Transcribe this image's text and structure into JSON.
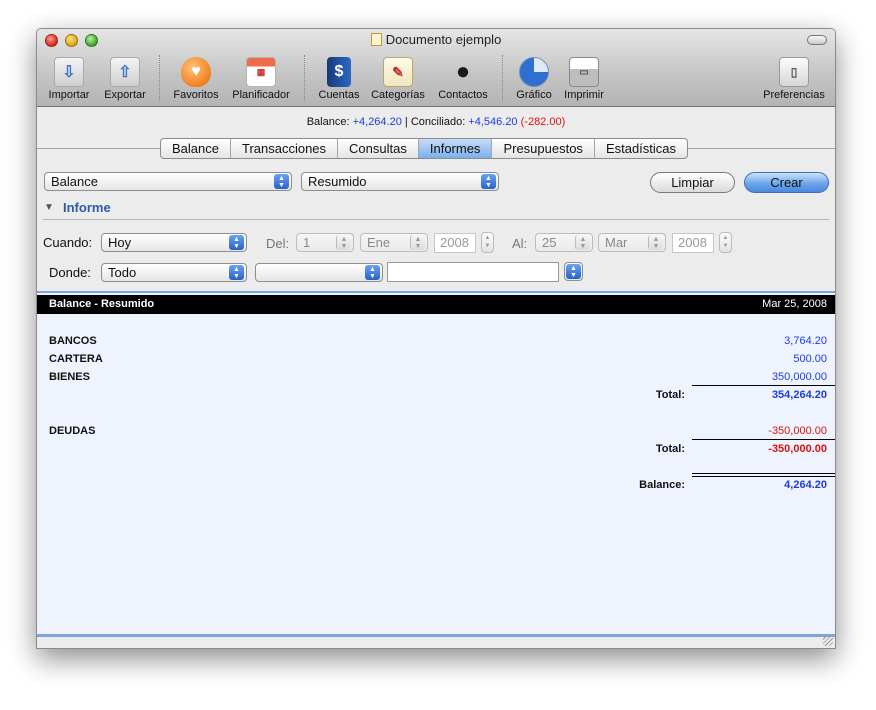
{
  "window": {
    "title": "Documento ejemplo"
  },
  "toolbar": {
    "items": [
      {
        "id": "importar",
        "label": "Importar",
        "icon": "import-icon",
        "color": "#5a8fd6"
      },
      {
        "id": "exportar",
        "label": "Exportar",
        "icon": "export-icon",
        "color": "#5a8fd6"
      },
      {
        "id": "favoritos",
        "label": "Favoritos",
        "icon": "heart-icon",
        "color": "#f08a2a"
      },
      {
        "id": "planificador",
        "label": "Planificador",
        "icon": "calendar-icon",
        "color": "#e0583a"
      },
      {
        "id": "cuentas",
        "label": "Cuentas",
        "icon": "ledger-icon",
        "color": "#2b5fb0"
      },
      {
        "id": "categorias",
        "label": "Categorías",
        "icon": "notepad-icon",
        "color": "#c9a74a"
      },
      {
        "id": "contactos",
        "label": "Contactos",
        "icon": "person-icon",
        "color": "#222222"
      },
      {
        "id": "grafico",
        "label": "Gráfico",
        "icon": "pie-chart-icon",
        "color": "#3c7fd8"
      },
      {
        "id": "imprimir",
        "label": "Imprimir",
        "icon": "printer-icon",
        "color": "#a0a0a0"
      },
      {
        "id": "preferencias",
        "label": "Preferencias",
        "icon": "switch-icon",
        "color": "#cfcfcf"
      }
    ]
  },
  "summary": {
    "balance_label": "Balance:",
    "balance_value": "+4,264.20",
    "separator": " | ",
    "conciliado_label": "Conciliado:",
    "conciliado_value": "+4,546.20",
    "difference": "(-282.00)"
  },
  "tabs": [
    "Balance",
    "Transacciones",
    "Consultas",
    "Informes",
    "Presupuestos",
    "Estadísticas"
  ],
  "active_tab": "Informes",
  "report_controls": {
    "type_value": "Balance",
    "mode_value": "Resumido",
    "limpiar_label": "Limpiar",
    "crear_label": "Crear",
    "section_title": "Informe",
    "cuando_label": "Cuando:",
    "cuando_value": "Hoy",
    "del_label": "Del:",
    "del_day": "1",
    "del_month": "Ene",
    "del_year": "2008",
    "al_label": "Al:",
    "al_day": "25",
    "al_month": "Mar",
    "al_year": "2008",
    "donde_label": "Donde:",
    "donde_value": "Todo",
    "donde_filter": "",
    "donde_text": ""
  },
  "report": {
    "title": "Balance - Resumido",
    "date": "Mar 25, 2008",
    "assets": [
      {
        "label": "BANCOS",
        "value": "3,764.20"
      },
      {
        "label": "CARTERA",
        "value": "500.00"
      },
      {
        "label": "BIENES",
        "value": "350,000.00"
      }
    ],
    "assets_total_label": "Total:",
    "assets_total": "354,264.20",
    "debts": [
      {
        "label": "DEUDAS",
        "value": "-350,000.00"
      }
    ],
    "debts_total_label": "Total:",
    "debts_total": "-350,000.00",
    "balance_label": "Balance:",
    "balance_value": "4,264.20"
  },
  "colors": {
    "positive": "#1b3fd6",
    "negative": "#d9140f",
    "selection": "#7bb0ee"
  }
}
